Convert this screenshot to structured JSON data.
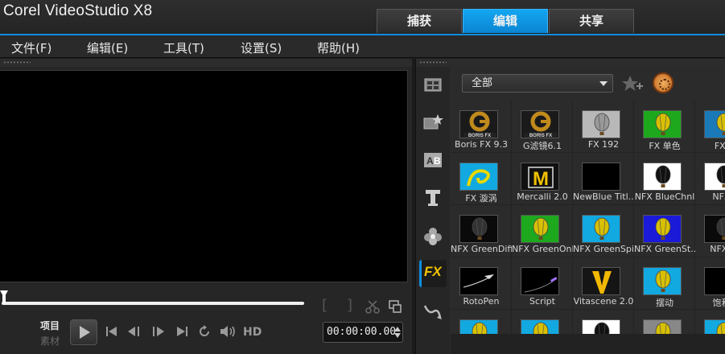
{
  "app": {
    "title": "Corel VideoStudio X8"
  },
  "mode_tabs": [
    {
      "label": "捕获",
      "active": false
    },
    {
      "label": "编辑",
      "active": true
    },
    {
      "label": "共享",
      "active": false
    }
  ],
  "menu": [
    {
      "label": "文件(F)"
    },
    {
      "label": "编辑(E)"
    },
    {
      "label": "工具(T)"
    },
    {
      "label": "设置(S)"
    },
    {
      "label": "帮助(H)"
    }
  ],
  "player": {
    "mode_project": "项目",
    "mode_clip": "素材",
    "hd_label": "HD",
    "timecode": "00:00:00.00",
    "mark_in": "[",
    "mark_out": "]",
    "progress": 0
  },
  "library": {
    "category": "全部",
    "filters": [
      {
        "label": "Boris FX 9.3",
        "thumb": "boris-g",
        "accent": "#c08a1c"
      },
      {
        "label": "G滤镜6.1",
        "thumb": "boris-g",
        "accent": "#c08a1c"
      },
      {
        "label": "FX 192",
        "thumb": "balloon",
        "accent": "#b8b8b8"
      },
      {
        "label": "FX 单色",
        "thumb": "balloon",
        "accent": "#1ea81e"
      },
      {
        "label": "FX 涂",
        "thumb": "balloon",
        "accent": "#1a7ab8"
      },
      {
        "label": "FX 漩涡",
        "thumb": "swirl",
        "accent": "#12a8e0"
      },
      {
        "label": "Mercalli 2.0",
        "thumb": "mercalli",
        "accent": "#f0c000"
      },
      {
        "label": "NewBlue Titl...",
        "thumb": "black",
        "accent": "#000000"
      },
      {
        "label": "NFX BlueChnl",
        "thumb": "balloon",
        "accent": "#ffffff"
      },
      {
        "label": "NFX B",
        "thumb": "balloon",
        "accent": "#ffffff"
      },
      {
        "label": "NFX GreenDiff",
        "thumb": "balloon",
        "accent": "#111111"
      },
      {
        "label": "NFX GreenOnly",
        "thumb": "balloon",
        "accent": "#1ea81e"
      },
      {
        "label": "NFX GreenSpill",
        "thumb": "balloon",
        "accent": "#12a8e0"
      },
      {
        "label": "NFX GreenSt...",
        "thumb": "balloon",
        "accent": "#1a1ad8"
      },
      {
        "label": "NFX Re",
        "thumb": "balloon",
        "accent": "#111111"
      },
      {
        "label": "RotoPen",
        "thumb": "roto",
        "accent": "#000000"
      },
      {
        "label": "Script",
        "thumb": "script",
        "accent": "#000000"
      },
      {
        "label": "Vitascene 2.0",
        "thumb": "vitascene",
        "accent": "#f0b800"
      },
      {
        "label": "摆动",
        "thumb": "balloon",
        "accent": "#12a8e0"
      },
      {
        "label": "饱和度",
        "thumb": "black",
        "accent": "#111111"
      },
      {
        "label": "",
        "thumb": "balloon",
        "accent": "#12a8e0"
      },
      {
        "label": "",
        "thumb": "balloon",
        "accent": "#12a8e0"
      },
      {
        "label": "",
        "thumb": "balloon",
        "accent": "#ffffff"
      },
      {
        "label": "",
        "thumb": "balloon",
        "accent": "#888888"
      },
      {
        "label": "",
        "thumb": "balloon",
        "accent": "#12a8e0"
      }
    ],
    "sidebar_icons": [
      {
        "icon": "media-icon",
        "active": false
      },
      {
        "icon": "instant-project-icon",
        "active": false
      },
      {
        "icon": "transition-icon",
        "active": false
      },
      {
        "icon": "title-icon",
        "active": false
      },
      {
        "icon": "graphic-icon",
        "active": false
      },
      {
        "icon": "filter-icon",
        "active": true,
        "label": "FX"
      },
      {
        "icon": "path-icon",
        "active": false
      }
    ]
  },
  "colors": {
    "accent": "#0e8ee0",
    "active_tab": "#14a6f2"
  }
}
